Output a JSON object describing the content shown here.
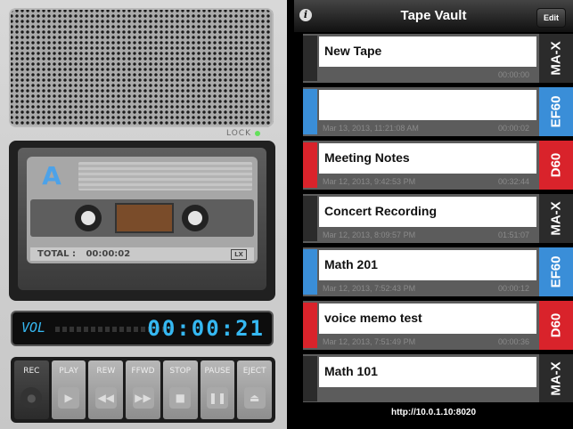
{
  "recorder": {
    "lock_label": "LOCK",
    "cassette_side": "A",
    "total_label": "TOTAL :",
    "total_time": "00:00:02",
    "lx_label": "LX",
    "vol_label": "VOL",
    "counter": "00:00:21",
    "buttons": [
      "REC",
      "PLAY",
      "REW",
      "FFWD",
      "STOP",
      "PAUSE",
      "EJECT"
    ]
  },
  "vault": {
    "title": "Tape Vault",
    "edit_label": "Edit",
    "tapes": [
      {
        "name": "New Tape",
        "date": "",
        "duration": "00:00:00",
        "type": "MA-X",
        "color": "#2b2b2b"
      },
      {
        "name": "",
        "date": "Mar 13, 2013, 11:21:08 AM",
        "duration": "00:00:02",
        "type": "EF60",
        "color": "#3a8ed8"
      },
      {
        "name": "Meeting Notes",
        "date": "Mar 12, 2013, 9:42:53 PM",
        "duration": "00:32:44",
        "type": "D60",
        "color": "#d9232b"
      },
      {
        "name": "Concert Recording",
        "date": "Mar 12, 2013, 8:09:57 PM",
        "duration": "01:51:07",
        "type": "MA-X",
        "color": "#2b2b2b"
      },
      {
        "name": "Math 201",
        "date": "Mar 12, 2013, 7:52:43 PM",
        "duration": "00:00:12",
        "type": "EF60",
        "color": "#3a8ed8"
      },
      {
        "name": "voice memo test",
        "date": "Mar 12, 2013, 7:51:49 PM",
        "duration": "00:00:36",
        "type": "D60",
        "color": "#d9232b"
      },
      {
        "name": "Math 101",
        "date": "",
        "duration": "",
        "type": "MA-X",
        "color": "#2b2b2b"
      }
    ],
    "footer_url": "http://10.0.1.10:8020"
  }
}
